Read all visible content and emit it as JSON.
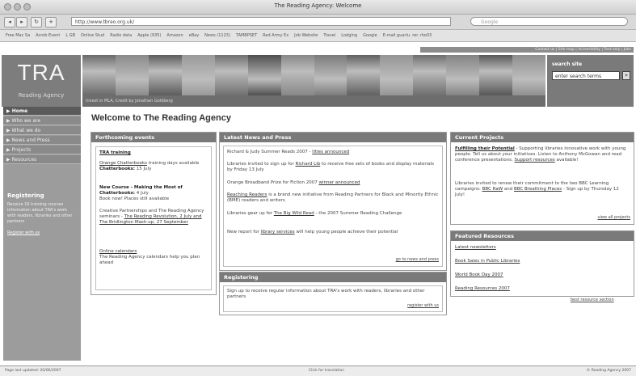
{
  "browser": {
    "window_title": "The Reading Agency: Welcome",
    "url": "http://www.tbreo.org.uk/",
    "search_placeholder": "Google",
    "back_label": "◂",
    "forward_label": "▸",
    "reload_label": "↻",
    "add_label": "+",
    "bookmarks": [
      "Free Mac Sa",
      "Acrob Event",
      "L GB",
      "Online Stud",
      "Radio data",
      "Apple (935)",
      "Amazon",
      "eBay",
      "News (1123)",
      "TAMBPSET",
      "Red Army Ex",
      "Job Website",
      "Travel",
      "Lodging",
      "Google",
      "E-mail guarlu. rer. rko03"
    ]
  },
  "header": {
    "utility_links": "Contact us | Site map | Accessibility | Text only | Jobs",
    "logo_text": "TRA",
    "logo_sub": "Reading Agency",
    "caption": "Invest in MLA, Credit by Jonathan Goldberg",
    "search_label": "search site",
    "search_placeholder": "enter search terms",
    "search_go": "»"
  },
  "sidebar": {
    "items": [
      {
        "label": "▶ Home"
      },
      {
        "label": "▶ Who we are"
      },
      {
        "label": "▶ What we do"
      },
      {
        "label": "▶ News and Press"
      },
      {
        "label": "▶ Projects"
      },
      {
        "label": "▶ Resources"
      }
    ],
    "registering_title": "Registering",
    "registering_text": "Receive 16 training courses information about TRA's work with readers, libraries and other partners",
    "registering_link": "Register with us"
  },
  "main": {
    "title": "Welcome to The Reading Agency",
    "events": {
      "heading": "Forthcoming events",
      "training_title": "TRA training",
      "e1_link": "Orange Chatterbooks",
      "e1_text": "training days available",
      "e1_bold": "Chatterbooks:",
      "e1_date": "15 July",
      "e2_title": "New Course - Making the Most of Chatterbooks:",
      "e2_date": "4 July",
      "e2_note": "Book now! Places still available",
      "e3_text": "Creative Partnerships and The Reading Agency seminars -",
      "e3_link": "The Reading Revolution, 2 July and The Bridlington Mash-up, 27 September",
      "calendar_link": "Online calendars",
      "calendar_text": "The Reading Agency calendars help you plan ahead"
    },
    "news": {
      "heading": "Latest News and Press",
      "n1_text": "Richard & Judy Summer Reads 2007 -",
      "n1_link": "titles announced",
      "n2_pre": "Libraries invited to sign up for",
      "n2_link": "Richard Lib",
      "n2_post": "to receive free sets of books and display materials by Friday 13 July",
      "n3_text": "Orange Broadband Prize for Fiction 2007",
      "n3_link": "winner announced",
      "n4_link": "Reaching Readers",
      "n4_text": "is a brand new initiative from Reading Partners for Black and Minority Ethnic (BME) readers and writers",
      "n5_pre": "Libraries gear up for",
      "n5_link": "The Big Wild Read",
      "n5_post": "- the 2007 Summer Reading Challenge",
      "n6_pre": "New report for",
      "n6_link": "library services",
      "n6_post": "will help young people achieve their potential",
      "more": "go to news and press"
    },
    "registering": {
      "heading": "Registering",
      "text": "Sign up to receive regular information about TRA's work with readers, libraries and other partners",
      "link": "register with us"
    },
    "projects": {
      "heading": "Current Projects",
      "p1_link": "Fulfilling their Potential",
      "p1_text": "- Supporting libraries innovative work with young people. Tell us about your initiatives. Listen to Anthony McGowan and read conference presentations.",
      "p1_link2": "Support resources",
      "p1_tail": "available!",
      "p2_text": "Libraries invited to renew their commitment to the two BBC Learning campaigns:",
      "p2_link1": "BBC RaW",
      "p2_and": "and",
      "p2_link2": "BBC Breathing Places",
      "p2_tail": "- Sign up by Thursday 12 July!",
      "more": "view all projects"
    },
    "resources": {
      "heading": "Featured Resources",
      "items": [
        "Latest newsletters",
        "Book Sales in Public Libraries",
        "World Book Day 2007",
        "Reading Resources 2007"
      ],
      "more": "best resource section"
    }
  },
  "footer": {
    "left": "Page last updated: 20/06/2007",
    "center": "Click for translation",
    "right": "© Reading Agency 2007"
  }
}
